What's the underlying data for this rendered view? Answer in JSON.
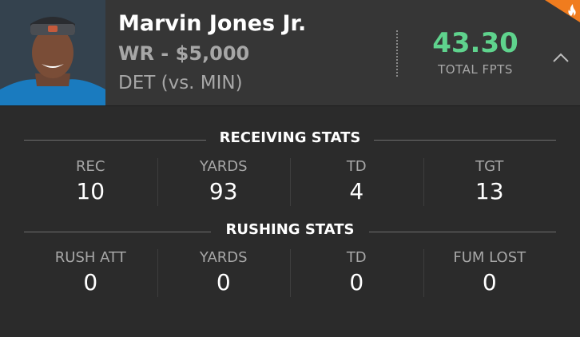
{
  "player": {
    "name": "Marvin Jones Jr.",
    "position_salary": "WR - $5,000",
    "team_matchup": "DET (vs. MIN)",
    "fpts_value": "43.30",
    "fpts_label": "TOTAL FPTS"
  },
  "icons": {
    "collapse": "chevron-up-icon",
    "hot": "flame-icon",
    "photo": "player-headshot"
  },
  "colors": {
    "fpts": "#5fd38d",
    "hot_badge": "#f07c1e",
    "background": "#2b2b2b",
    "header": "#363636"
  },
  "receiving": {
    "title": "RECEIVING STATS",
    "stats": [
      {
        "label": "REC",
        "value": "10"
      },
      {
        "label": "YARDS",
        "value": "93"
      },
      {
        "label": "TD",
        "value": "4"
      },
      {
        "label": "TGT",
        "value": "13"
      }
    ]
  },
  "rushing": {
    "title": "RUSHING STATS",
    "stats": [
      {
        "label": "RUSH ATT",
        "value": "0"
      },
      {
        "label": "YARDS",
        "value": "0"
      },
      {
        "label": "TD",
        "value": "0"
      },
      {
        "label": "FUM LOST",
        "value": "0"
      }
    ]
  }
}
